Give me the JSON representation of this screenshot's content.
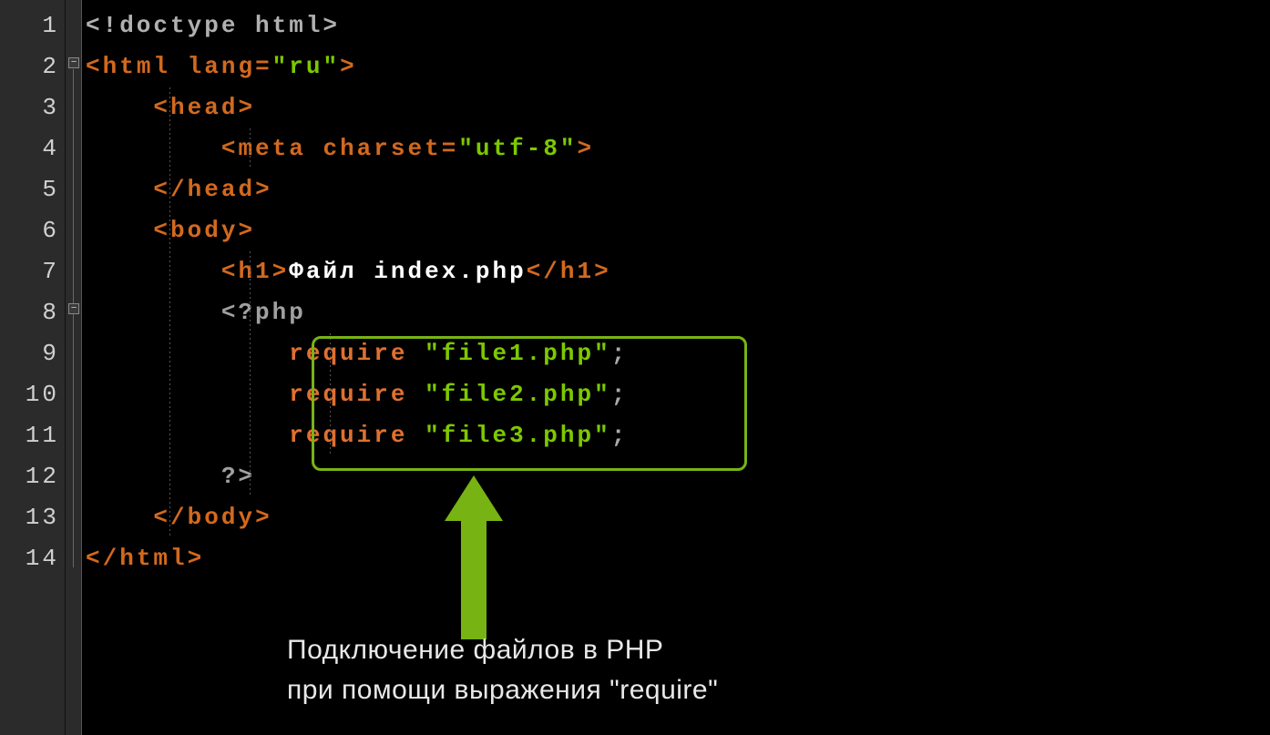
{
  "lineNumbers": [
    "1",
    "2",
    "3",
    "4",
    "5",
    "6",
    "7",
    "8",
    "9",
    "10",
    "11",
    "12",
    "13",
    "14"
  ],
  "code": {
    "l1": {
      "doctype": "<!doctype html>"
    },
    "l2": {
      "open": "<",
      "tag": "html",
      "sp": " ",
      "attr": "lang",
      "eq": "=",
      "q": "\"",
      "val": "ru",
      "close": ">"
    },
    "l3": {
      "open": "<",
      "tag": "head",
      "close": ">"
    },
    "l4": {
      "open": "<",
      "tag": "meta",
      "sp": " ",
      "attr": "charset",
      "eq": "=",
      "q": "\"",
      "val": "utf-8",
      "close": ">"
    },
    "l5": {
      "open": "</",
      "tag": "head",
      "close": ">"
    },
    "l6": {
      "open": "<",
      "tag": "body",
      "close": ">"
    },
    "l7": {
      "openA": "<",
      "tagA": "h1",
      "closeA": ">",
      "text": "Файл index.php",
      "openB": "</",
      "tagB": "h1",
      "closeB": ">"
    },
    "l8": {
      "php": "<?php"
    },
    "l9": {
      "kw": "require",
      "sp": " ",
      "q": "\"",
      "val": "file1.php",
      "semi": ";"
    },
    "l10": {
      "kw": "require",
      "sp": " ",
      "q": "\"",
      "val": "file2.php",
      "semi": ";"
    },
    "l11": {
      "kw": "require",
      "sp": " ",
      "q": "\"",
      "val": "file3.php",
      "semi": ";"
    },
    "l12": {
      "php": "?>"
    },
    "l13": {
      "open": "</",
      "tag": "body",
      "close": ">"
    },
    "l14": {
      "open": "</",
      "tag": "html",
      "close": ">"
    }
  },
  "caption": {
    "line1": "Подключение файлов в PHP",
    "line2": "при помощи выражения \"require\""
  },
  "colors": {
    "tag": "#d2691e",
    "string": "#7cc900",
    "keyword": "#e07030",
    "highlight": "#78b314"
  }
}
